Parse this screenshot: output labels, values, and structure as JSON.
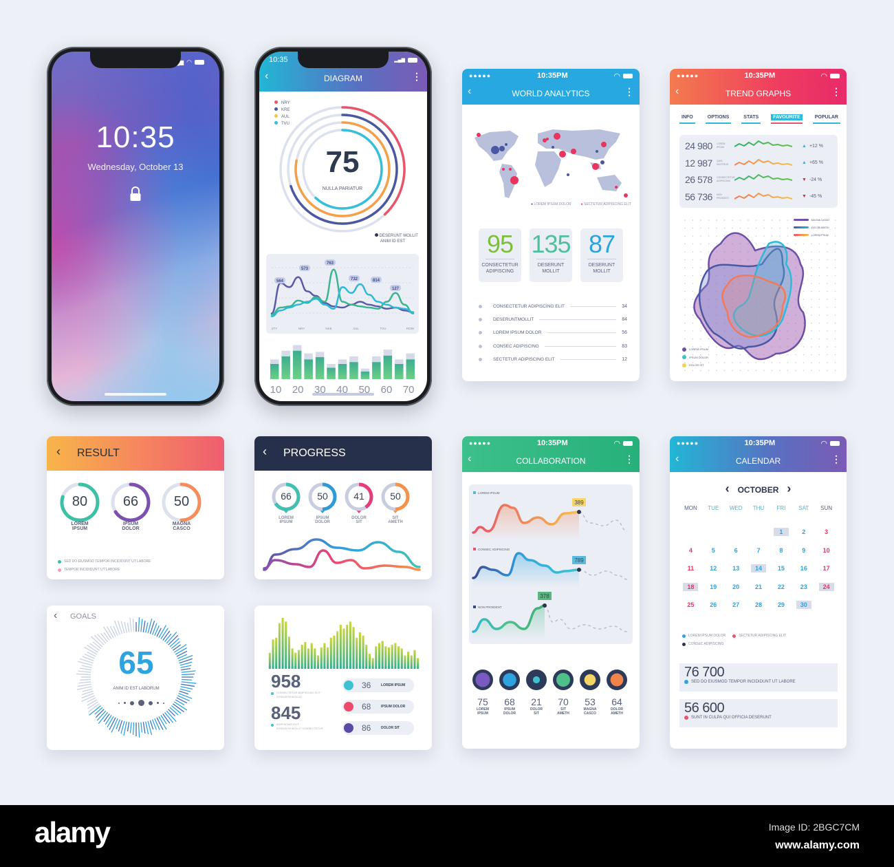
{
  "lock_phone": {
    "time": "10:35",
    "date": "Wednesday, October 13",
    "lock_icon": "lock-icon"
  },
  "diagram_phone": {
    "status_time": "10:35",
    "title": "DIAGRAM",
    "legend": [
      {
        "label": "NRY",
        "color": "#e8546a"
      },
      {
        "label": "KRE",
        "color": "#4a57a3"
      },
      {
        "label": "AUL",
        "color": "#f4c542"
      },
      {
        "label": "TVU",
        "color": "#35bfd9"
      }
    ],
    "gauge_value": "75",
    "gauge_label": "NULLA PARIATUR",
    "rings": [
      {
        "name": "NRY",
        "fraction": 0.38,
        "color": "#e8546a"
      },
      {
        "name": "KRE",
        "fraction": 0.7,
        "color": "#4a57a3"
      },
      {
        "name": "AUL",
        "fraction": 0.78,
        "color": "#f5a049"
      },
      {
        "name": "TVU",
        "fraction": 0.62,
        "color": "#35bfd9"
      }
    ],
    "note_line1": "DESERUNT MOLLIT",
    "note_line2": "ANIM ID EST",
    "line_chart": {
      "x_labels": [
        "ZTY",
        "NRY",
        "NKE",
        "AUL",
        "TVU",
        "ROW"
      ],
      "callouts": [
        "564",
        "573",
        "763",
        "732",
        "814",
        "127"
      ],
      "series": [
        {
          "name": "purple",
          "color": "#5a5aa8",
          "values": [
            10,
            62,
            55,
            72,
            48,
            40,
            28,
            22,
            20,
            25,
            30,
            25,
            22,
            18,
            20,
            15,
            12
          ]
        },
        {
          "name": "green",
          "color": "#3bb58f",
          "values": [
            8,
            20,
            22,
            32,
            28,
            38,
            30,
            85,
            30,
            25,
            22,
            20,
            18,
            30,
            45,
            25,
            10
          ]
        },
        {
          "name": "cyan",
          "color": "#2fb8d8",
          "values": [
            5,
            15,
            20,
            25,
            30,
            35,
            25,
            18,
            55,
            45,
            60,
            42,
            30,
            25,
            20,
            18,
            12
          ]
        }
      ]
    },
    "bar_chart": {
      "x_labels": [
        "10",
        "20",
        "30",
        "40",
        "50",
        "60",
        "70"
      ],
      "front": [
        40,
        60,
        75,
        52,
        58,
        30,
        40,
        45,
        20,
        45,
        62,
        40,
        52
      ],
      "back": [
        52,
        75,
        90,
        68,
        72,
        40,
        52,
        60,
        28,
        60,
        78,
        52,
        68
      ]
    }
  },
  "world_analytics": {
    "status_time": "10:35PM",
    "title": "WORLD ANALYTICS",
    "map_legend": [
      "LOREM IPSUM DOLOR",
      "SECTETUR ADIPISCING ELIT"
    ],
    "stats": [
      {
        "value": "95",
        "label1": "CONSECTETUR",
        "label2": "ADIPISCING",
        "color": "#7bbf3d"
      },
      {
        "value": "135",
        "label1": "DESERUNT",
        "label2": "MOLLIT",
        "color": "#4fbf9f"
      },
      {
        "value": "87",
        "label1": "DESERUNT",
        "label2": "MOLLIT",
        "color": "#2ba3dc"
      }
    ],
    "list": [
      {
        "label": "CONSECTETUR ADIPISCING ELIT",
        "value": "34"
      },
      {
        "label": "DESERUNTMOLLIT",
        "value": "84"
      },
      {
        "label": "LOREM IPSUM DOLOR",
        "value": "56"
      },
      {
        "label": "CONSEC ADIPISCING",
        "value": "83"
      },
      {
        "label": "SECTETUR ADIPISCING ELIT",
        "value": "12"
      }
    ]
  },
  "trend_graphs": {
    "status_time": "10:35PM",
    "title": "TREND GRAPHS",
    "tabs": [
      {
        "label": "INFO",
        "active": false
      },
      {
        "label": "OPTIONS",
        "active": false
      },
      {
        "label": "STATS",
        "active": false
      },
      {
        "label": "FAVOURITE",
        "active": true
      },
      {
        "label": "POPULAR",
        "active": false
      }
    ],
    "rows": [
      {
        "value": "24 980",
        "sub1": "LOREM",
        "sub2": "IPSUM",
        "change": "+12 %",
        "dir": "up",
        "color": "#2fae6a"
      },
      {
        "value": "12 987",
        "sub1": "QUIS",
        "sub2": "NOSTRUD",
        "change": "+65 %",
        "dir": "up",
        "color": "#f08550"
      },
      {
        "value": "26 578",
        "sub1": "CONSECTETUR",
        "sub2": "ADIPISCING",
        "change": "-24 %",
        "dir": "down",
        "color": "#3cb370"
      },
      {
        "value": "56 736",
        "sub1": "NON",
        "sub2": "PROIDENT",
        "change": "-45 %",
        "dir": "down",
        "color": "#f07a52"
      }
    ],
    "top_legend": [
      "MAGNA CASCO",
      "DOLOR AMETH",
      "LOREM IPSUM"
    ],
    "bottom_legend": [
      {
        "label": "LOREM IPSUM",
        "color": "#6a4fa6"
      },
      {
        "label": "IPSUM DOLOR",
        "color": "#3fc2c9"
      },
      {
        "label": "DOLOR SIT",
        "color": "#f6ce5b"
      }
    ]
  },
  "result": {
    "title": "RESULT",
    "gauges": [
      {
        "value": "80",
        "label1": "LOREM",
        "label2": "IPSUM",
        "fraction": 0.8,
        "color": "#3cc0a6"
      },
      {
        "value": "66",
        "label1": "IPSUM",
        "label2": "DOLOR",
        "fraction": 0.66,
        "color": "#7c4fb0"
      },
      {
        "value": "50",
        "label1": "MAGNA",
        "label2": "CASCO",
        "fraction": 0.5,
        "color": "#f58c5a"
      }
    ],
    "legend": [
      {
        "label": "SED DO EIUSMOD TEMPOR INCIDIDUNT UT LABORE",
        "color": "#3cc0a6"
      },
      {
        "label": "TEMPOR INCIDIDUNT UT LABORE",
        "color": "#f49ab5"
      }
    ]
  },
  "progress": {
    "title": "PROGRESS",
    "pins": [
      {
        "value": "66",
        "label1": "LOREM",
        "label2": "IPSUM",
        "fraction": 0.66,
        "color": "#3fc0b0"
      },
      {
        "value": "50",
        "label1": "IPSUM",
        "label2": "DOLOR",
        "fraction": 0.5,
        "color": "#2e9ad8"
      },
      {
        "value": "41",
        "label1": "DOLOR",
        "label2": "SIT",
        "fraction": 0.41,
        "color": "#e53c7c"
      },
      {
        "value": "50",
        "label1": "SIT",
        "label2": "AMETH",
        "fraction": 0.5,
        "color": "#f5924a"
      }
    ]
  },
  "goals": {
    "title": "GOALS",
    "value": "65",
    "label": "ANIM ID EST LABORUM",
    "fraction": 0.65
  },
  "bars_card": {
    "bar_values": [
      30,
      55,
      58,
      85,
      95,
      88,
      60,
      38,
      30,
      35,
      45,
      50,
      38,
      48,
      38,
      25,
      40,
      48,
      40,
      58,
      62,
      70,
      82,
      75,
      82,
      88,
      78,
      58,
      68,
      62,
      45,
      28,
      20,
      42,
      48,
      52,
      42,
      40,
      45,
      48,
      42,
      38,
      25,
      32,
      25,
      35,
      20
    ],
    "stats": [
      {
        "value": "958",
        "line1": "CONSECTETUR ADIPISCING ELIT",
        "line2": "IUSDUM IN MOLLIS"
      },
      {
        "value": "845",
        "line1": "ADIPISCING ELIT",
        "line2": "IUSDUM IN MOLLIT CONSECTETUR"
      }
    ],
    "pills": [
      {
        "value": "36",
        "label": "LOREM IPSUM",
        "color": "#3fc2cf"
      },
      {
        "value": "68",
        "label": "IPSUM DOLOR",
        "color": "#ef4a6a"
      },
      {
        "value": "86",
        "label": "DOLOR SIT",
        "color": "#5a4aa6"
      }
    ]
  },
  "collaboration": {
    "status_time": "10:35PM",
    "title": "COLLABORATION",
    "charts": [
      {
        "label": "LOREM IPSUM",
        "callout": "389",
        "label_color": "#5bb6d6",
        "callout_color": "#f6d66a"
      },
      {
        "label": "CONSEC ADIPISCING",
        "callout": "789",
        "label_color": "#e8546a",
        "callout_color": "#5bbbd8"
      },
      {
        "label": "NON PROIDENT",
        "callout": "378",
        "label_color": "#3c4a7a",
        "callout_color": "#5bb57e"
      }
    ],
    "circles": [
      {
        "value": "75",
        "label1": "LOREM",
        "label2": "IPSUM",
        "fraction": 0.75,
        "color": "#7a59c0"
      },
      {
        "value": "68",
        "label1": "IPSUM",
        "label2": "DOLOR",
        "fraction": 0.68,
        "color": "#2ea3e0"
      },
      {
        "value": "21",
        "label1": "DOLOR",
        "label2": "SIT",
        "fraction": 0.21,
        "color": "#3fc2cf"
      },
      {
        "value": "70",
        "label1": "SIT",
        "label2": "AMETH",
        "fraction": 0.7,
        "color": "#4fc08a"
      },
      {
        "value": "53",
        "label1": "MAGNA",
        "label2": "CASCO",
        "fraction": 0.53,
        "color": "#f6d365"
      },
      {
        "value": "64",
        "label1": "DOLOR",
        "label2": "AMETH",
        "fraction": 0.64,
        "color": "#f0844a"
      }
    ]
  },
  "calendar": {
    "status_time": "10:35PM",
    "title": "CALENDAR",
    "month": "OCTOBER",
    "weekdays": [
      "MON",
      "TUE",
      "WED",
      "THU",
      "FRI",
      "SAT",
      "SUN"
    ],
    "first_weekday_index": 4,
    "days_in_month": 30,
    "red_days": [
      3,
      4,
      10,
      11,
      17,
      18,
      24,
      25
    ],
    "highlighted_days": [
      1,
      14,
      18,
      24,
      30
    ],
    "legend": [
      {
        "label": "LOREM IPSUM DOLOR",
        "color": "#2ea3e0"
      },
      {
        "label": "SECTETUR ADIPISCING ELIT",
        "color": "#e8546a"
      },
      {
        "label": "CONSEC ADIPISCING",
        "color": "#2d3450"
      }
    ],
    "stats": [
      {
        "value": "76 700",
        "label": "SED DO EIUSMOD TEMPOR INCIDIDUNT UT LABORE",
        "color": "#2ea3e0"
      },
      {
        "value": "56 600",
        "label": "SUNT IN CULPA QUI OFFICIA DESERUNT",
        "color": "#e8546a"
      }
    ]
  },
  "footer": {
    "brand": "alamy",
    "image_id": "Image ID: 2BGC7CM",
    "url": "www.alamy.com"
  }
}
